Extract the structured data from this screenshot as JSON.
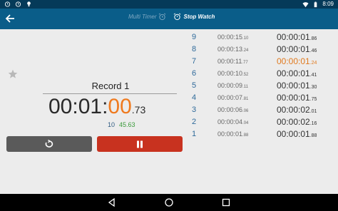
{
  "status": {
    "time": "8:09"
  },
  "tabs": [
    {
      "label": "Multi Timer",
      "active": false
    },
    {
      "label": "Stop Watch",
      "active": true
    }
  ],
  "record": {
    "title": "Record 1",
    "time_main": "00:01:",
    "time_highlight": "00",
    "time_hundredths": ".73",
    "lap_count": "10",
    "lap_time": "45.63"
  },
  "laps": [
    {
      "num": "9",
      "split_main": "00:00:15",
      "split_small": ".10",
      "total_main": "00:00:01",
      "total_small": ".86",
      "best": false
    },
    {
      "num": "8",
      "split_main": "00:00:13",
      "split_small": ".24",
      "total_main": "00:00:01",
      "total_small": ".46",
      "best": false
    },
    {
      "num": "7",
      "split_main": "00:00:11",
      "split_small": ".77",
      "total_main": "00:00:01",
      "total_small": ".24",
      "best": true
    },
    {
      "num": "6",
      "split_main": "00:00:10",
      "split_small": ".52",
      "total_main": "00:00:01",
      "total_small": ".41",
      "best": false
    },
    {
      "num": "5",
      "split_main": "00:00:09",
      "split_small": ".11",
      "total_main": "00:00:01",
      "total_small": ".30",
      "best": false
    },
    {
      "num": "4",
      "split_main": "00:00:07",
      "split_small": ".81",
      "total_main": "00:00:01",
      "total_small": ".75",
      "best": false
    },
    {
      "num": "3",
      "split_main": "00:00:06",
      "split_small": ".06",
      "total_main": "00:00:02",
      "total_small": ".01",
      "best": false
    },
    {
      "num": "2",
      "split_main": "00:00:04",
      "split_small": ".04",
      "total_main": "00:00:02",
      "total_small": ".16",
      "best": false
    },
    {
      "num": "1",
      "split_main": "00:00:01",
      "split_small": ".88",
      "total_main": "00:00:01",
      "total_small": ".88",
      "best": false
    }
  ],
  "colors": {
    "accent": "#ef7a1f",
    "appbar": "#0a5d89",
    "statusbar": "#053a59",
    "pause": "#c8321f",
    "reset": "#5a5a5a",
    "lap_time": "#3a9a3a"
  },
  "icons": [
    "back-arrow-icon",
    "alarm-clock-icon",
    "stopwatch-icon",
    "star-icon",
    "reset-icon",
    "pause-icon",
    "nav-back-icon",
    "nav-home-icon",
    "nav-recents-icon"
  ]
}
